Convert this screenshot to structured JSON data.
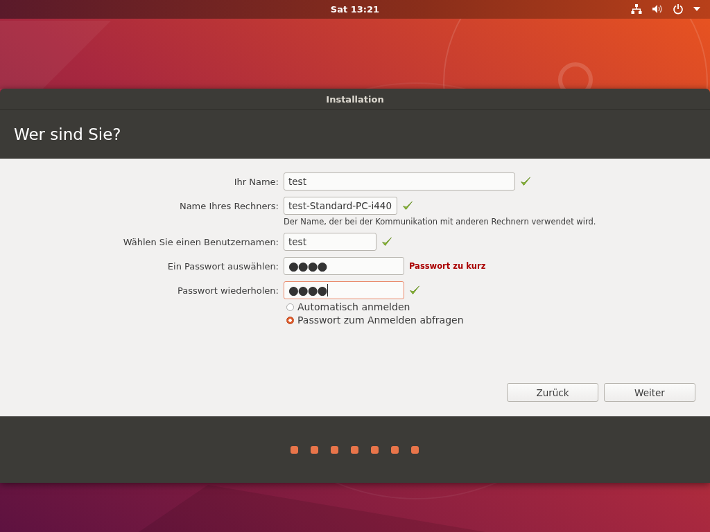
{
  "top_bar": {
    "clock": "Sat 13:21"
  },
  "window": {
    "title": "Installation",
    "heading": "Wer sind Sie?"
  },
  "fields": [
    {
      "label": "Ihr Name:",
      "value": "test",
      "kind": "wide",
      "valid": true,
      "focused": false
    },
    {
      "label": "Name Ihres Rechners:",
      "value": "test-Standard-PC-i440",
      "kind": "medium",
      "valid": true,
      "focused": false,
      "hint": "Der Name, der bei der Kommunikation mit anderen Rechnern verwendet wird."
    },
    {
      "label": "Wählen Sie einen Benutzernamen:",
      "value": "test",
      "kind": "small",
      "valid": true,
      "focused": false
    },
    {
      "label": "Ein Passwort auswählen:",
      "value": "●●●●",
      "kind": "password",
      "valid": false,
      "message": "Passwort zu kurz",
      "focused": false
    },
    {
      "label": "Passwort wiederholen:",
      "value": "●●●●",
      "kind": "password",
      "valid": true,
      "focused": true
    }
  ],
  "login_options": [
    {
      "label": "Automatisch anmelden",
      "selected": false
    },
    {
      "label": "Passwort zum Anmelden abfragen",
      "selected": true
    }
  ],
  "buttons": [
    "Zurück",
    "Weiter"
  ],
  "progress_dots": [
    {
      "done": true
    },
    {
      "done": true
    },
    {
      "done": true
    },
    {
      "done": true
    },
    {
      "done": true
    },
    {
      "done": true
    },
    {
      "done": true
    }
  ]
}
